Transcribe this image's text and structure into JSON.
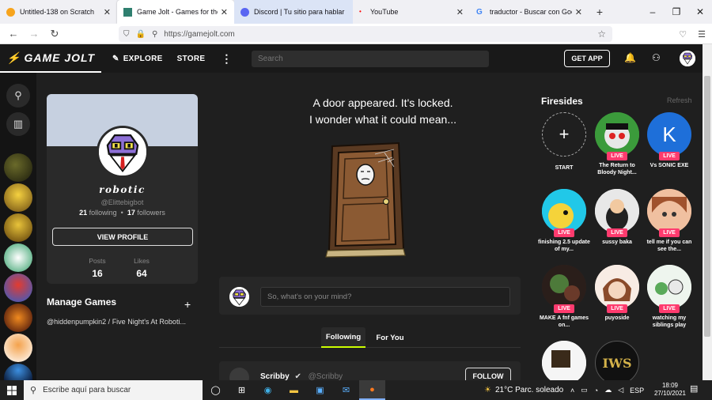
{
  "browser": {
    "tabs": [
      {
        "title": "Untitled-138 on Scratch",
        "favicon_color": "#f7a41d"
      },
      {
        "title": "Game Jolt - Games for the love",
        "favicon_color": "#2f7f6f"
      },
      {
        "title": "Discord | Tu sitio para hablar y p",
        "favicon_color": "#5865f2"
      },
      {
        "title": "YouTube",
        "favicon_color": "#ff0000"
      },
      {
        "title": "traductor - Buscar con Google",
        "favicon_color": "#4285f4"
      }
    ],
    "new_tab": "+",
    "url": "https://gamejolt.com",
    "window_controls": [
      "–",
      "❐",
      "✕"
    ]
  },
  "gj_nav": {
    "logo": "GAME JOLT",
    "explore": "EXPLORE",
    "store": "STORE",
    "more": "⋮",
    "search_placeholder": "Search",
    "get_app": "GET APP"
  },
  "profile": {
    "username": "robotic",
    "handle": "@Elittebigbot",
    "following_count": "21",
    "following_label": "following",
    "followers_count": "17",
    "followers_label": "followers",
    "view_profile": "VIEW PROFILE",
    "posts_label": "Posts",
    "posts_count": "16",
    "likes_label": "Likes",
    "likes_count": "64"
  },
  "manage_games": {
    "title": "Manage Games",
    "add": "+",
    "items": [
      "@hiddenpumpkin2 / Five Night's At Roboti..."
    ]
  },
  "door": {
    "line1": "A door appeared. It's locked.",
    "line2": "I wonder what it could mean..."
  },
  "post_box": {
    "placeholder": "So, what's on your mind?"
  },
  "feed_tabs": [
    "Following",
    "For You"
  ],
  "feed_item": {
    "name": "Scribby",
    "handle": "@Scribby",
    "follow": "FOLLOW"
  },
  "firesides": {
    "title": "Firesides",
    "refresh": "Refresh",
    "start_label": "START",
    "live_label": "LIVE",
    "items": [
      {
        "caption": "The Return to Bloody Night...",
        "color": "#3b9b3b"
      },
      {
        "caption": "Vs SONIC EXE",
        "color": "#1e6fd9"
      },
      {
        "caption": "finishing 2.5 update of my...",
        "color": "#21c8e8"
      },
      {
        "caption": "sussy baka",
        "color": "#eeeeee"
      },
      {
        "caption": "tell me if you can see the...",
        "color": "#e08a5a"
      },
      {
        "caption": "MAKE A fnf games on...",
        "color": "#3a2a2a"
      },
      {
        "caption": "puyoside",
        "color": "#f3e1d6"
      },
      {
        "caption": "watching my siblings play",
        "color": "#dfeee0"
      },
      {
        "caption": "",
        "color": "#f5f5f5"
      },
      {
        "caption": "",
        "color": "#111111"
      }
    ],
    "iws_text": "IWS"
  },
  "taskbar": {
    "search_placeholder": "Escribe aquí para buscar",
    "weather": "21°C  Parc. soleado",
    "lang": "ESP",
    "time": "18:09",
    "date": "27/10/2021"
  }
}
